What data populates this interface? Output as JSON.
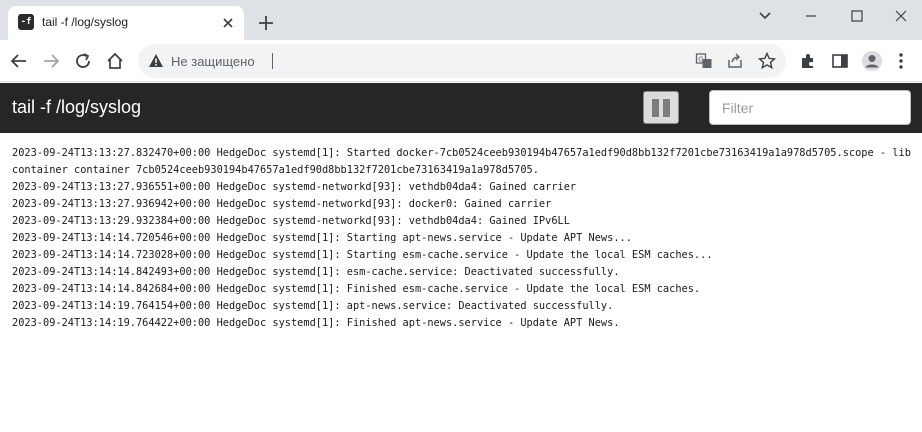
{
  "browser": {
    "tab": {
      "title": "tail -f /log/syslog",
      "favicon_text": "-f"
    },
    "omnibox": {
      "security_label": "Не защищено",
      "url": ""
    },
    "icons": [
      "translate-icon",
      "share-icon",
      "star-icon",
      "extensions-icon",
      "side-panel-icon",
      "profile-icon",
      "menu-icon"
    ]
  },
  "app": {
    "title": "tail -f /log/syslog",
    "filter_placeholder": "Filter",
    "filter_value": ""
  },
  "log": {
    "lines": [
      "2023-09-24T13:13:27.832470+00:00 HedgeDoc systemd[1]: Started docker-7cb0524ceeb930194b47657a1edf90d8bb132f7201cbe73163419a1a978d5705.scope - libcontainer container 7cb0524ceeb930194b47657a1edf90d8bb132f7201cbe73163419a1a978d5705.",
      "2023-09-24T13:13:27.936551+00:00 HedgeDoc systemd-networkd[93]: vethdb04da4: Gained carrier",
      "2023-09-24T13:13:27.936942+00:00 HedgeDoc systemd-networkd[93]: docker0: Gained carrier",
      "2023-09-24T13:13:29.932384+00:00 HedgeDoc systemd-networkd[93]: vethdb04da4: Gained IPv6LL",
      "2023-09-24T13:14:14.720546+00:00 HedgeDoc systemd[1]: Starting apt-news.service - Update APT News...",
      "2023-09-24T13:14:14.723028+00:00 HedgeDoc systemd[1]: Starting esm-cache.service - Update the local ESM caches...",
      "2023-09-24T13:14:14.842493+00:00 HedgeDoc systemd[1]: esm-cache.service: Deactivated successfully.",
      "2023-09-24T13:14:14.842684+00:00 HedgeDoc systemd[1]: Finished esm-cache.service - Update the local ESM caches.",
      "2023-09-24T13:14:19.764154+00:00 HedgeDoc systemd[1]: apt-news.service: Deactivated successfully.",
      "2023-09-24T13:14:19.764422+00:00 HedgeDoc systemd[1]: Finished apt-news.service - Update APT News."
    ]
  }
}
